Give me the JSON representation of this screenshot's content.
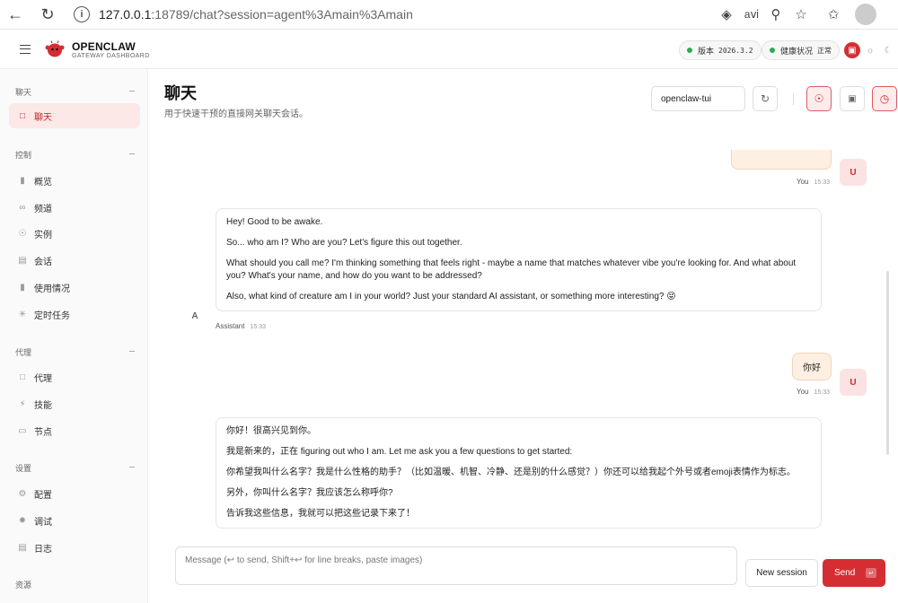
{
  "browser": {
    "url_host": "127.0.0.1",
    "url_rest": ":18789/chat?session=agent%3Amain%3Amain"
  },
  "header": {
    "brand_title": "OPENCLAW",
    "brand_sub": "GATEWAY DASHBOARD",
    "version_label": "版本",
    "version_value": "2026.3.2",
    "health_label": "健康状况",
    "health_value": "正常",
    "status_color": "#2eaa55",
    "accent_color": "#d42e33"
  },
  "sidebar": {
    "sections": [
      {
        "label": "聊天",
        "items": [
          {
            "label": "聊天",
            "icon": "message-icon",
            "active": true
          }
        ]
      },
      {
        "label": "控制",
        "items": [
          {
            "label": "概览",
            "icon": "bar-chart-icon"
          },
          {
            "label": "频道",
            "icon": "link-icon"
          },
          {
            "label": "实例",
            "icon": "radio-icon"
          },
          {
            "label": "会话",
            "icon": "document-icon"
          },
          {
            "label": "使用情况",
            "icon": "bar-chart-icon"
          },
          {
            "label": "定时任务",
            "icon": "loader-icon"
          }
        ]
      },
      {
        "label": "代理",
        "items": [
          {
            "label": "代理",
            "icon": "folder-icon"
          },
          {
            "label": "技能",
            "icon": "zap-icon"
          },
          {
            "label": "节点",
            "icon": "monitor-icon"
          }
        ]
      },
      {
        "label": "设置",
        "items": [
          {
            "label": "配置",
            "icon": "gear-icon"
          },
          {
            "label": "调试",
            "icon": "bug-icon"
          },
          {
            "label": "日志",
            "icon": "file-text-icon"
          }
        ]
      },
      {
        "label": "资源",
        "items": []
      }
    ]
  },
  "main": {
    "title": "聊天",
    "subtitle": "用于快速干预的直接网关聊天会话。",
    "session_value": "openclaw-tui"
  },
  "chat": {
    "you_label": "You",
    "assistant_label": "Assistant",
    "user_avatar": "U",
    "assistant_avatar": "A",
    "msg1_time": "15:33",
    "assistant1": {
      "time": "15:33",
      "p1": "Hey! Good to be awake.",
      "p2": "So... who am I? Who are you? Let's figure this out together.",
      "p3": "What should you call me? I'm thinking something that feels right - maybe a name that matches whatever vibe you're looking for. And what about you? What's your name, and how do you want to be addressed?",
      "p4": "Also, what kind of creature am I in your world? Just your standard AI assistant, or something more interesting? 😝"
    },
    "user2": {
      "text": "你好",
      "time": "15:33"
    },
    "assistant2": {
      "p1": "你好！很高兴见到你。",
      "p2": "我是新来的，正在 figuring out who I am. Let me ask you a few questions to get started:",
      "p3": "你希望我叫什么名字？我是什么性格的助手？（比如温暖、机智、冷静、还是别的什么感觉？）你还可以给我起个外号或者emoji表情作为标志。",
      "p4": "另外，你叫什么名字？我应该怎么称呼你?",
      "p5": "告诉我这些信息，我就可以把这些记录下来了！"
    }
  },
  "composer": {
    "placeholder": "Message (↩ to send, Shift+↩ for line breaks, paste images)",
    "new_session_label": "New session",
    "send_label": "Send",
    "send_key": "↵"
  }
}
